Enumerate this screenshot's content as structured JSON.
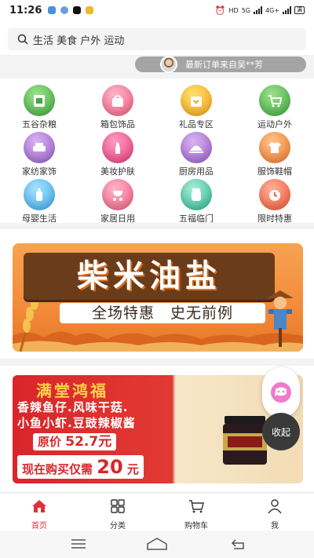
{
  "status_bar": {
    "time": "11:26",
    "right_text_1": "HD",
    "right_text_2": "5G",
    "right_text_3": "4G+",
    "battery": "满"
  },
  "search": {
    "placeholder": "生活 美食 户外 运动"
  },
  "order_ticker": {
    "text": "最新订单来自吴**芳"
  },
  "categories": [
    {
      "label": "五谷杂粮",
      "icon": "grain-bag-icon",
      "color": "#3faa3f"
    },
    {
      "label": "箱包饰品",
      "icon": "handbag-icon",
      "color": "#f05d80"
    },
    {
      "label": "礼品专区",
      "icon": "gift-box-icon",
      "color": "#f6a21b"
    },
    {
      "label": "运动户外",
      "icon": "cart-icon",
      "color": "#3faa3f"
    },
    {
      "label": "家纺家饰",
      "icon": "sofa-icon",
      "color": "#9a5bc8"
    },
    {
      "label": "美妆护肤",
      "icon": "lipstick-icon",
      "color": "#e73b78"
    },
    {
      "label": "厨房用品",
      "icon": "cloche-icon",
      "color": "#9a5bc8"
    },
    {
      "label": "服饰鞋帽",
      "icon": "shirt-icon",
      "color": "#f07a2a"
    },
    {
      "label": "母婴生活",
      "icon": "baby-bottle-icon",
      "color": "#3aa8e8"
    },
    {
      "label": "家居日用",
      "icon": "stroller-icon",
      "color": "#f05d80"
    },
    {
      "label": "五福临门",
      "icon": "jar-icon",
      "color": "#2fb78f"
    },
    {
      "label": "限时特惠",
      "icon": "alarm-clock-icon",
      "color": "#f05533"
    }
  ],
  "banner1": {
    "title": "柴米油盐",
    "subtitle": "全场特惠　史无前例"
  },
  "banner2": {
    "title": "满堂鸿福",
    "line1": "香辣鱼仔.风味干菇.",
    "line2": "小鱼小虾.豆豉辣椒酱",
    "price_label": "原价",
    "price_value": "52.7元",
    "now_label": "现在购买仅需",
    "now_value": "20",
    "now_unit": "元"
  },
  "float": {
    "collapse_label": "收起"
  },
  "bottom_nav": [
    {
      "label": "首页",
      "icon": "home-icon",
      "active": true
    },
    {
      "label": "分类",
      "icon": "category-grid-icon",
      "active": false
    },
    {
      "label": "购物车",
      "icon": "shopping-cart-icon",
      "active": false
    },
    {
      "label": "我",
      "icon": "user-icon",
      "active": false
    }
  ],
  "accent_color": "#e0303a"
}
